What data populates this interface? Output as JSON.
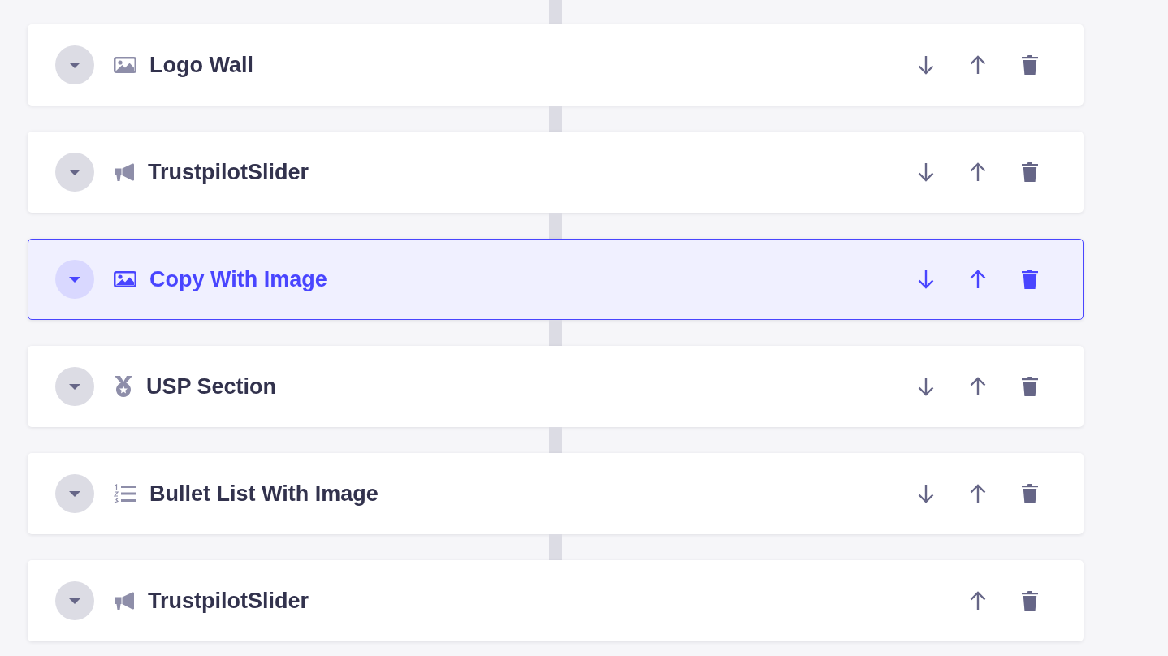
{
  "sections": [
    {
      "title": "Logo Wall",
      "kind": "image",
      "selected": false,
      "can_move_down": true,
      "can_move_up": true
    },
    {
      "title": "TrustpilotSlider",
      "kind": "megaphone",
      "selected": false,
      "can_move_down": true,
      "can_move_up": true
    },
    {
      "title": "Copy With Image",
      "kind": "image",
      "selected": true,
      "can_move_down": true,
      "can_move_up": true
    },
    {
      "title": "USP Section",
      "kind": "medal",
      "selected": false,
      "can_move_down": true,
      "can_move_up": true
    },
    {
      "title": "Bullet List With Image",
      "kind": "numbered-list",
      "selected": false,
      "can_move_down": true,
      "can_move_up": true
    },
    {
      "title": "TrustpilotSlider",
      "kind": "megaphone",
      "selected": false,
      "can_move_down": false,
      "can_move_up": true
    }
  ]
}
